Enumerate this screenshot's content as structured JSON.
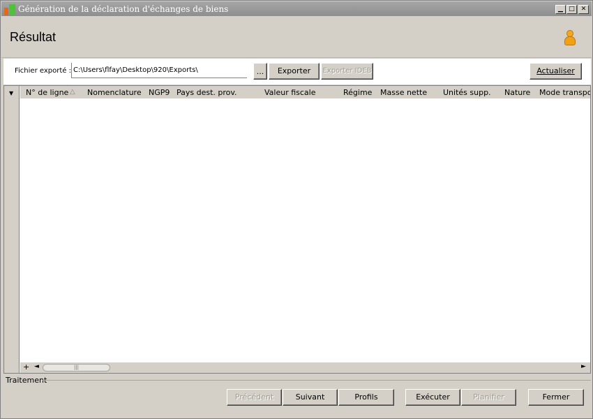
{
  "window": {
    "title": "Génération de la déclaration d'échanges de biens",
    "min_glyph": "▁",
    "max_glyph": "□",
    "close_glyph": "✕"
  },
  "header": {
    "title": "Résultat",
    "icon": "user-icon"
  },
  "toolbar": {
    "file_label": "Fichier exporté :",
    "file_path": "C:\\Users\\flfay\\Desktop\\920\\Exports\\",
    "browse_label": "...",
    "export_label": "Exporter",
    "export_ideb_label": "Exporter IDEB",
    "refresh_label": "Actualiser"
  },
  "grid": {
    "menu_glyph": "▼",
    "sort_glyph": "△",
    "columns": [
      "N° de ligne",
      "Nomenclature",
      "NGP9",
      "Pays dest. prov.",
      "Valeur fiscale",
      "Régime",
      "Masse nette",
      "Unités supp.",
      "Nature",
      "Mode transport"
    ],
    "rows": [],
    "scroll_plus": "+",
    "scroll_left": "◄",
    "scroll_right": "►",
    "thumb_grip": "|||"
  },
  "section": {
    "label": "Traitement"
  },
  "footer": {
    "previous_label": "Précédent",
    "next_label": "Suivant",
    "profiles_label": "Profils",
    "execute_label": "Exécuter",
    "schedule_label": "Planifier",
    "close_label": "Fermer"
  }
}
